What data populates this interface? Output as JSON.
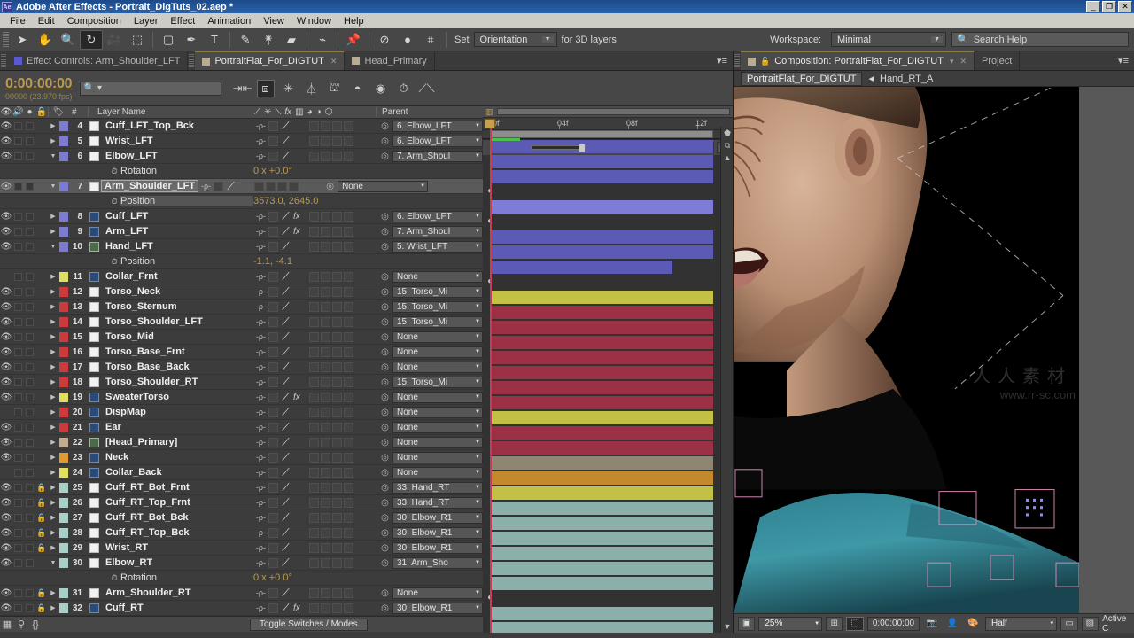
{
  "window": {
    "title": "Adobe After Effects - Portrait_DigTuts_02.aep *",
    "logo": "Ae",
    "minimize": "_",
    "maximize": "❐",
    "close": "✕"
  },
  "menubar": {
    "items": [
      "File",
      "Edit",
      "Composition",
      "Layer",
      "Effect",
      "Animation",
      "View",
      "Window",
      "Help"
    ]
  },
  "toolbar": {
    "tools": [
      "selection-tool",
      "hand-tool",
      "zoom-tool",
      "rotation-tool",
      "camera-tool",
      "pan-behind-tool",
      "shape-tool",
      "pen-tool",
      "text-tool",
      "brush-tool",
      "clone-stamp-tool",
      "eraser-tool",
      "roto-brush-tool",
      "puppet-pin-tool"
    ],
    "set_label": "Set",
    "orientation_value": "Orientation",
    "for3d_label": "for 3D layers",
    "workspace_label": "Workspace:",
    "workspace_value": "Minimal",
    "search_help_placeholder": "Search Help"
  },
  "left_tabs": [
    {
      "label": "Effect Controls: Arm_Shoulder_LFT",
      "color": "#5a5ad0",
      "active": false,
      "closable": false
    },
    {
      "label": "PortraitFlat_For_DIGTUT",
      "color": "#b9ac93",
      "active": true,
      "closable": true
    },
    {
      "label": "Head_Primary",
      "color": "#b9ac93",
      "active": false,
      "closable": false
    }
  ],
  "timeline_toolbar": {
    "timecode": "0:00:00:00",
    "frames": "00000 (23.970 fps)",
    "search_placeholder": "",
    "icons": [
      "live-update-icon",
      "draft-3d-icon",
      "motion-blur-icon",
      "frame-blend-icon",
      "shy-icon",
      "graph-editor-icon",
      "brainstorm-icon",
      "auto-keyframe-icon"
    ]
  },
  "layer_headers": {
    "eye": "eye-icon",
    "audio": "audio-icon",
    "solo": "solo-icon",
    "lock": "lock-icon",
    "tag": "label-icon",
    "num": "#",
    "name": "Layer Name",
    "switches": [
      "shy-icon",
      "collapse-icon",
      "quality-icon",
      "fx-icon",
      "frame-blend-icon",
      "motion-blur-icon",
      "adjustment-icon",
      "3d-icon"
    ],
    "parent": "Parent"
  },
  "layers": [
    {
      "num": "4",
      "name": "Cuff_LFT_Top_Bck",
      "color": "#7b7bd0",
      "eye": true,
      "lock": false,
      "expanded": false,
      "type": "solid",
      "fx": false,
      "parent": "6. Elbow_LFT",
      "bar": "#5b5bb5",
      "barEnd": 1.0
    },
    {
      "num": "5",
      "name": "Wrist_LFT",
      "color": "#7b7bd0",
      "eye": true,
      "lock": false,
      "expanded": false,
      "type": "solid",
      "fx": false,
      "parent": "6. Elbow_LFT",
      "bar": "#5b5bb5",
      "barEnd": 1.0
    },
    {
      "num": "6",
      "name": "Elbow_LFT",
      "color": "#7b7bd0",
      "eye": true,
      "lock": false,
      "expanded": true,
      "type": "solid",
      "fx": false,
      "parent": "7. Arm_Shoul",
      "bar": "#5b5bb5",
      "barEnd": 1.0
    },
    {
      "prop": true,
      "prop_name": "Rotation",
      "prop_value": "0 x +0.0°",
      "highlight": false
    },
    {
      "num": "7",
      "name": "Arm_Shoulder_LFT",
      "color": "#7b7bd0",
      "eye": true,
      "lock": false,
      "expanded": true,
      "type": "solid",
      "fx": false,
      "parent": "None",
      "selected": true,
      "name_boxed": true,
      "bar": "#7d7dd8",
      "barEnd": 1.0
    },
    {
      "prop": true,
      "prop_name": "Position",
      "prop_value": "3573.0, 2645.0",
      "highlight": true
    },
    {
      "num": "8",
      "name": "Cuff_LFT",
      "color": "#7b7bd0",
      "eye": true,
      "lock": false,
      "expanded": false,
      "type": "ps",
      "fx": true,
      "parent": "6. Elbow_LFT",
      "bar": "#5b5bb5",
      "barEnd": 1.0
    },
    {
      "num": "9",
      "name": "Arm_LFT",
      "color": "#7b7bd0",
      "eye": true,
      "lock": false,
      "expanded": false,
      "type": "ps",
      "fx": true,
      "parent": "7. Arm_Shoul",
      "bar": "#5b5bb5",
      "barEnd": 1.0
    },
    {
      "num": "10",
      "name": "Hand_LFT",
      "color": "#7b7bd0",
      "eye": true,
      "lock": false,
      "expanded": true,
      "type": "comp",
      "fx": false,
      "parent": "5. Wrist_LFT",
      "bar": "#5b5bb5",
      "barEnd": 0.8
    },
    {
      "prop": true,
      "prop_name": "Position",
      "prop_value": "-1.1, -4.1",
      "highlight": false
    },
    {
      "num": "11",
      "name": "Collar_Frnt",
      "color": "#e0dd63",
      "eye": false,
      "lock": false,
      "expanded": false,
      "type": "ps",
      "fx": false,
      "parent": "None",
      "bar": "#c3c046",
      "barEnd": 1.0
    },
    {
      "num": "12",
      "name": "Torso_Neck",
      "color": "#cc3b3b",
      "eye": true,
      "lock": false,
      "expanded": false,
      "type": "solid",
      "fx": false,
      "parent": "15. Torso_Mi",
      "bar": "#9c3146",
      "barEnd": 1.0
    },
    {
      "num": "13",
      "name": "Torso_Sternum",
      "color": "#cc3b3b",
      "eye": true,
      "lock": false,
      "expanded": false,
      "type": "solid",
      "fx": false,
      "parent": "15. Torso_Mi",
      "bar": "#9c3146",
      "barEnd": 1.0
    },
    {
      "num": "14",
      "name": "Torso_Shoulder_LFT",
      "color": "#cc3b3b",
      "eye": true,
      "lock": false,
      "expanded": false,
      "type": "solid",
      "fx": false,
      "parent": "15. Torso_Mi",
      "bar": "#9c3146",
      "barEnd": 1.0
    },
    {
      "num": "15",
      "name": "Torso_Mid",
      "color": "#cc3b3b",
      "eye": true,
      "lock": false,
      "expanded": false,
      "type": "solid",
      "fx": false,
      "parent": "None",
      "bar": "#9c3146",
      "barEnd": 1.0
    },
    {
      "num": "16",
      "name": "Torso_Base_Frnt",
      "color": "#cc3b3b",
      "eye": true,
      "lock": false,
      "expanded": false,
      "type": "solid",
      "fx": false,
      "parent": "None",
      "bar": "#9c3146",
      "barEnd": 1.0
    },
    {
      "num": "17",
      "name": "Torso_Base_Back",
      "color": "#cc3b3b",
      "eye": true,
      "lock": false,
      "expanded": false,
      "type": "solid",
      "fx": false,
      "parent": "None",
      "bar": "#9c3146",
      "barEnd": 1.0
    },
    {
      "num": "18",
      "name": "Torso_Shoulder_RT",
      "color": "#cc3b3b",
      "eye": true,
      "lock": false,
      "expanded": false,
      "type": "solid",
      "fx": false,
      "parent": "15. Torso_Mi",
      "bar": "#9c3146",
      "barEnd": 1.0
    },
    {
      "num": "19",
      "name": "SweaterTorso",
      "color": "#e0dd63",
      "eye": true,
      "lock": false,
      "expanded": false,
      "type": "ps",
      "fx": true,
      "parent": "None",
      "bar": "#c3c046",
      "barEnd": 1.0
    },
    {
      "num": "20",
      "name": "DispMap",
      "color": "#cc3b3b",
      "eye": false,
      "lock": false,
      "expanded": false,
      "type": "ps",
      "fx": false,
      "parent": "None",
      "bar": "#9c3146",
      "barEnd": 1.0
    },
    {
      "num": "21",
      "name": "Ear",
      "color": "#cc3b3b",
      "eye": true,
      "lock": false,
      "expanded": false,
      "type": "ps",
      "fx": false,
      "parent": "None",
      "bar": "#9c3146",
      "barEnd": 1.0
    },
    {
      "num": "22",
      "name": "[Head_Primary]",
      "color": "#c0ab8e",
      "eye": true,
      "lock": false,
      "expanded": false,
      "type": "comp",
      "fx": false,
      "parent": "None",
      "bar": "#8e8670",
      "barEnd": 1.0
    },
    {
      "num": "23",
      "name": "Neck",
      "color": "#e09a30",
      "eye": true,
      "lock": false,
      "expanded": false,
      "type": "ps",
      "fx": false,
      "parent": "None",
      "bar": "#c4892c",
      "barEnd": 1.0
    },
    {
      "num": "24",
      "name": "Collar_Back",
      "color": "#e0dd63",
      "eye": false,
      "lock": false,
      "expanded": false,
      "type": "ps",
      "fx": false,
      "parent": "None",
      "bar": "#c3c046",
      "barEnd": 1.0
    },
    {
      "num": "25",
      "name": "Cuff_RT_Bot_Frnt",
      "color": "#a9cfc9",
      "eye": true,
      "lock": true,
      "expanded": false,
      "type": "solid",
      "fx": false,
      "parent": "33. Hand_RT",
      "bar": "#8bb0ab",
      "barEnd": 1.0
    },
    {
      "num": "26",
      "name": "Cuff_RT_Top_Frnt",
      "color": "#a9cfc9",
      "eye": true,
      "lock": true,
      "expanded": false,
      "type": "solid",
      "fx": false,
      "parent": "33. Hand_RT",
      "bar": "#8bb0ab",
      "barEnd": 1.0
    },
    {
      "num": "27",
      "name": "Cuff_RT_Bot_Bck",
      "color": "#a9cfc9",
      "eye": true,
      "lock": true,
      "expanded": false,
      "type": "solid",
      "fx": false,
      "parent": "30. Elbow_R1",
      "bar": "#8bb0ab",
      "barEnd": 1.0
    },
    {
      "num": "28",
      "name": "Cuff_RT_Top_Bck",
      "color": "#a9cfc9",
      "eye": true,
      "lock": true,
      "expanded": false,
      "type": "solid",
      "fx": false,
      "parent": "30. Elbow_R1",
      "bar": "#8bb0ab",
      "barEnd": 1.0
    },
    {
      "num": "29",
      "name": "Wrist_RT",
      "color": "#a9cfc9",
      "eye": true,
      "lock": true,
      "expanded": false,
      "type": "solid",
      "fx": false,
      "parent": "30. Elbow_R1",
      "bar": "#8bb0ab",
      "barEnd": 1.0
    },
    {
      "num": "30",
      "name": "Elbow_RT",
      "color": "#a9cfc9",
      "eye": true,
      "lock": false,
      "expanded": true,
      "type": "solid",
      "fx": false,
      "parent": "31. Arm_Sho",
      "bar": "#8bb0ab",
      "barEnd": 1.0
    },
    {
      "prop": true,
      "prop_name": "Rotation",
      "prop_value": "0 x +0.0°",
      "highlight": false
    },
    {
      "num": "31",
      "name": "Arm_Shoulder_RT",
      "color": "#a9cfc9",
      "eye": true,
      "lock": true,
      "expanded": false,
      "type": "solid",
      "fx": false,
      "parent": "None",
      "bar": "#8bb0ab",
      "barEnd": 1.0
    },
    {
      "num": "32",
      "name": "Cuff_RT",
      "color": "#a9cfc9",
      "eye": true,
      "lock": true,
      "expanded": false,
      "type": "ps",
      "fx": true,
      "parent": "30. Elbow_R1",
      "bar": "#8bb0ab",
      "barEnd": 1.0
    }
  ],
  "timeline": {
    "ruler_ticks": [
      "00f",
      "04f",
      "08f",
      "12f"
    ],
    "toggle_switches_label": "Toggle Switches / Modes"
  },
  "right_tabs": [
    {
      "label": "Composition: PortraitFlat_For_DIGTUT",
      "active": true,
      "closable": true
    },
    {
      "label": "Project",
      "active": false,
      "closable": false
    }
  ],
  "comp_breadcrumb": {
    "comp": "PortraitFlat_For_DIGTUT",
    "layer": "Hand_RT_A",
    "arrow": "◂"
  },
  "comp_footer": {
    "zoom": "25%",
    "timecode": "0:00:00:00",
    "resolution": "Half",
    "view": "Active C",
    "icons": [
      "region-of-interest-icon",
      "grid-icon",
      "mask-icon",
      "snapshot-icon",
      "show-snapshot-icon",
      "channels-icon",
      "transparency-grid-icon",
      "toggle-mask-icon"
    ]
  },
  "watermarks": [
    "www.rr-sc.com",
    "人人素材"
  ]
}
